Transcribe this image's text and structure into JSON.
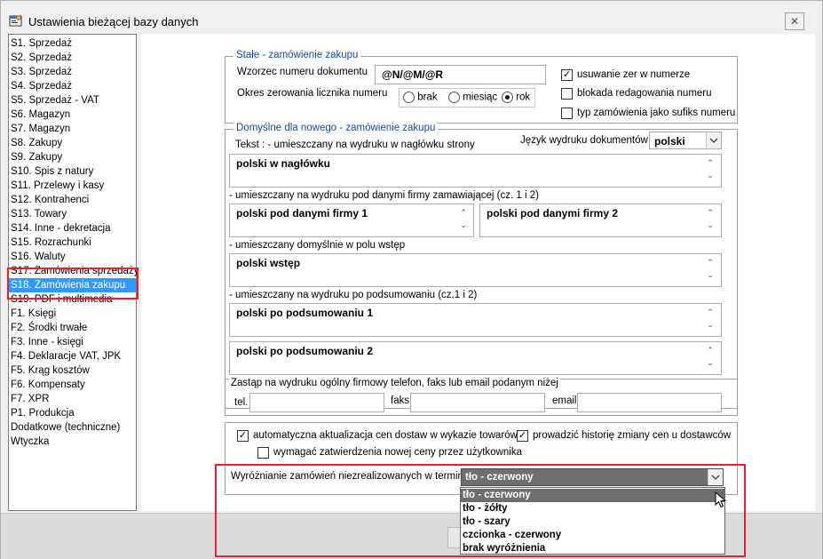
{
  "window": {
    "title": "Ustawienia bieżącej bazy danych",
    "close_label": "✕"
  },
  "sidebar": {
    "items": [
      {
        "label": "S1. Sprzedaż"
      },
      {
        "label": "S2. Sprzedaż"
      },
      {
        "label": "S3. Sprzedaż"
      },
      {
        "label": "S4. Sprzedaż"
      },
      {
        "label": "S5. Sprzedaż - VAT"
      },
      {
        "label": "S6. Magazyn"
      },
      {
        "label": "S7. Magazyn"
      },
      {
        "label": "S8. Zakupy"
      },
      {
        "label": "S9. Zakupy"
      },
      {
        "label": "S10. Spis z natury"
      },
      {
        "label": "S11. Przelewy i kasy"
      },
      {
        "label": "S12. Kontrahenci"
      },
      {
        "label": "S13. Towary"
      },
      {
        "label": "S14. Inne - dekretacja"
      },
      {
        "label": "S15. Rozrachunki"
      },
      {
        "label": "S16. Waluty"
      },
      {
        "label": "S17. Zamówienia sprzedaży"
      },
      {
        "label": "S18. Zamówienia zakupu"
      },
      {
        "label": "S19. PDF i multimedia"
      },
      {
        "label": "F1. Księgi"
      },
      {
        "label": "F2. Środki trwałe"
      },
      {
        "label": "F3. Inne - księgi"
      },
      {
        "label": "F4. Deklaracje VAT, JPK"
      },
      {
        "label": "F5. Krąg kosztów"
      },
      {
        "label": "F6. Kompensaty"
      },
      {
        "label": "F7. XPR"
      },
      {
        "label": "P1. Produkcja"
      },
      {
        "label": "Dodatkowe (techniczne)"
      },
      {
        "label": "Wtyczka"
      }
    ],
    "selected_index": 17
  },
  "group_stale": {
    "legend": "Stałe - zamówienie zakupu",
    "wzorzec_label": "Wzorzec numeru dokumentu",
    "wzorzec_value": "@N/@M/@R",
    "okres_label": "Okres zerowania licznika numeru",
    "radio_brak": "brak",
    "radio_miesiac": "miesiąc",
    "radio_rok": "rok",
    "selected_radio": "rok",
    "cb_usuwanie": "usuwanie zer w numerze",
    "cb_usuwanie_checked": true,
    "cb_blokada": "blokada redagowania numeru",
    "cb_blokada_checked": false,
    "cb_typ": "typ zamówienia jako sufiks numeru",
    "cb_typ_checked": false
  },
  "group_domyslne": {
    "legend": "Domyślne dla nowego - zamówienie zakupu",
    "tekst_label": "Tekst : - umieszczany na wydruku w nagłówku strony",
    "jezyk_label": "Język wydruku dokumentów",
    "jezyk_value": "polski",
    "naglowek_value": "polski w nagłówku",
    "pod_danymi_label": "- umieszczany na wydruku pod danymi firmy zamawiającej  (cz. 1 i 2)",
    "pod_danymi_1": "polski pod danymi firmy 1",
    "pod_danymi_2": "polski pod danymi firmy 2",
    "wstep_label": "- umieszczany domyślnie w polu wstęp",
    "wstep_value": "polski wstęp",
    "podsumowanie_label": "- umieszczany na wydruku po podsumowaniu (cz.1 i 2)",
    "podsumowanie_1": "polski po podsumowaniu 1",
    "podsumowanie_2": "polski po podsumowaniu 2"
  },
  "group_zastap": {
    "label": "Zastąp na wydruku ogólny firmowy telefon, faks lub email podanym niżej",
    "tel_label": "tel.",
    "tel_value": "",
    "faks_label": "faks",
    "faks_value": "",
    "email_label": "email",
    "email_value": ""
  },
  "group_ceny": {
    "cb_auto": "automatyczna aktualizacja cen dostaw w wykazie towarów",
    "cb_auto_checked": true,
    "cb_historia": "prowadzić historię zmiany cen u dostawców",
    "cb_historia_checked": true,
    "cb_zatwierdzenie": "wymagać zatwierdzenia nowej ceny przez użytkownika",
    "cb_zatwierdzenie_checked": false
  },
  "wyroznianie": {
    "label": "Wyróżnianie zamówień niezrealizowanych w terminie",
    "selected": "tło - czerwony",
    "options": [
      {
        "label": "tło - czerwony"
      },
      {
        "label": "tło - żółty"
      },
      {
        "label": "tło - szary"
      },
      {
        "label": "czcionka - czerwony"
      },
      {
        "label": "brak wyróżnienia"
      }
    ],
    "highlighted_index": 0
  },
  "icons": {
    "title_icon": "settings-window-icon",
    "dropdown_arrow": "chevron-down-icon"
  }
}
